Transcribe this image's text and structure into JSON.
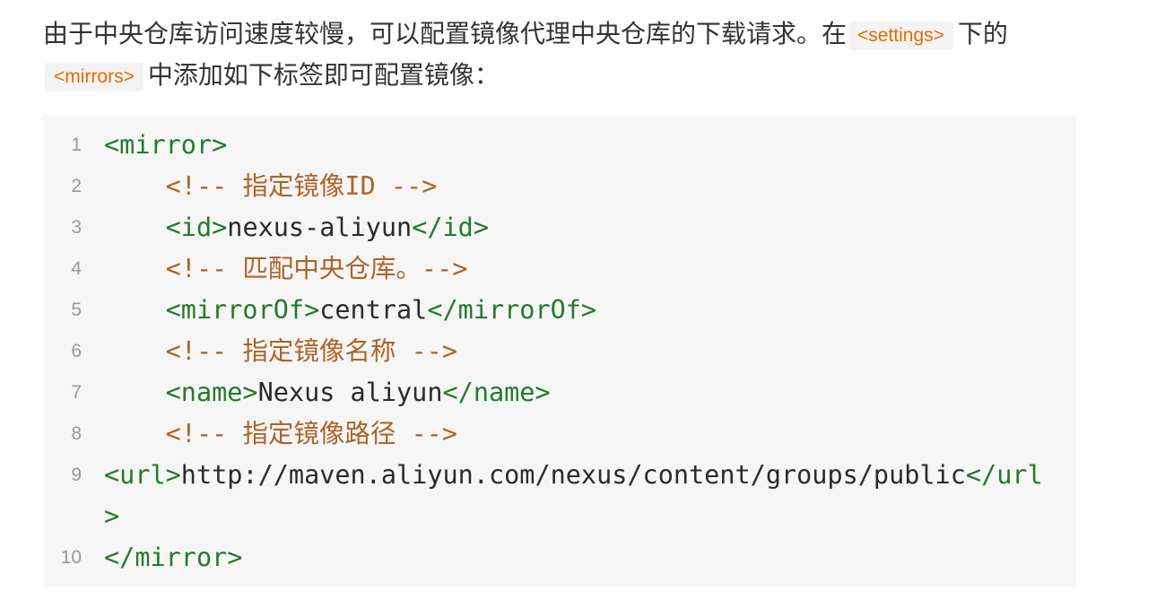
{
  "intro": {
    "text_before_settings": "由于中央仓库访问速度较慢，可以配置镜像代理中央仓库的下载请求。在",
    "settings_tag": "<settings>",
    "text_after_settings": "下的",
    "mirrors_tag": "<mirrors>",
    "text_after_mirrors": "中添加如下标签即可配置镜像："
  },
  "code_block": {
    "lines": [
      {
        "number": "1",
        "tokens": [
          {
            "tag": "<mirror>"
          }
        ]
      },
      {
        "number": "2",
        "tokens": [
          {
            "indent": "    "
          },
          {
            "comment": "<!-- 指定镜像ID -->"
          }
        ]
      },
      {
        "number": "3",
        "tokens": [
          {
            "indent": "    "
          },
          {
            "tag": "<id>"
          },
          {
            "text": "nexus-aliyun"
          },
          {
            "tag": "</id>"
          }
        ]
      },
      {
        "number": "4",
        "tokens": [
          {
            "indent": "    "
          },
          {
            "comment": "<!-- 匹配中央仓库。-->"
          }
        ]
      },
      {
        "number": "5",
        "tokens": [
          {
            "indent": "    "
          },
          {
            "tag": "<mirrorOf>"
          },
          {
            "text": "central"
          },
          {
            "tag": "</mirrorOf>"
          }
        ]
      },
      {
        "number": "6",
        "tokens": [
          {
            "indent": "    "
          },
          {
            "comment": "<!-- 指定镜像名称 -->"
          }
        ]
      },
      {
        "number": "7",
        "tokens": [
          {
            "indent": "    "
          },
          {
            "tag": "<name>"
          },
          {
            "text": "Nexus aliyun"
          },
          {
            "tag": "</name>"
          }
        ]
      },
      {
        "number": "8",
        "tokens": [
          {
            "indent": "    "
          },
          {
            "comment": "<!-- 指定镜像路径 -->"
          }
        ]
      },
      {
        "number": "9",
        "tokens": [
          {
            "tag": "<url>"
          },
          {
            "text": "http://maven.aliyun.com/nexus/content/groups/public"
          },
          {
            "tag": "</url>"
          }
        ]
      },
      {
        "number": "10",
        "tokens": [
          {
            "tag": "</mirror>"
          }
        ]
      }
    ]
  },
  "colors": {
    "text": "#333333",
    "inline_code": "#e96900",
    "inline_code_bg": "#f3f3f3",
    "code_bg": "#f6f6f6",
    "code_text": "#2b2b2b",
    "tag": "#237a2c",
    "comment": "#ad6428",
    "line_number": "#999999"
  }
}
